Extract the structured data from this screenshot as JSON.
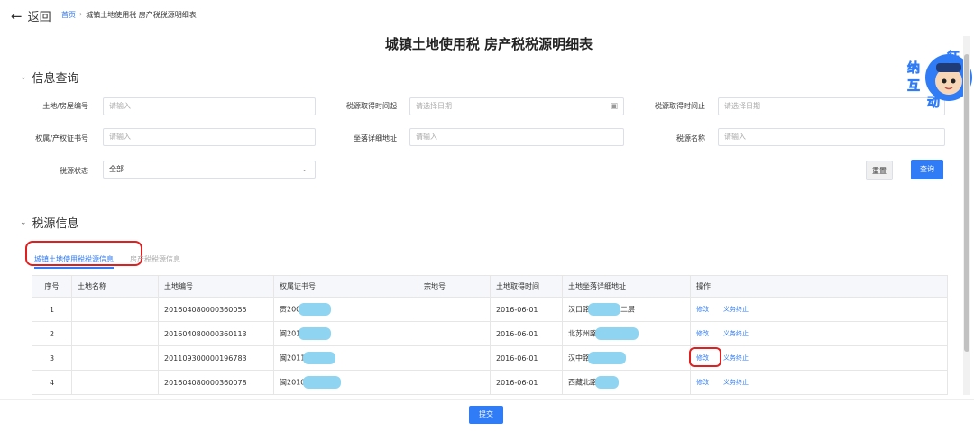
{
  "topbar": {
    "back_label": "返回",
    "breadcrumb_home": "首页",
    "breadcrumb_current": "城镇土地使用税 房产税税源明细表"
  },
  "page_title": "城镇土地使用税 房产税税源明细表",
  "query_section": {
    "heading": "信息查询",
    "fields": {
      "land_house_no": {
        "label": "土地/房屋编号",
        "placeholder": "请输入"
      },
      "start_date": {
        "label": "税源取得时间起",
        "placeholder": "请选择日期"
      },
      "end_date": {
        "label": "税源取得时间止",
        "placeholder": "请选择日期"
      },
      "cert_no": {
        "label": "权属/产权证书号",
        "placeholder": "请输入"
      },
      "address": {
        "label": "坐落详细地址",
        "placeholder": "请输入"
      },
      "tax_name": {
        "label": "税源名称",
        "placeholder": "请输入"
      },
      "status": {
        "label": "税源状态",
        "value": "全部"
      }
    },
    "reset_label": "重置",
    "query_label": "查询"
  },
  "info_section": {
    "heading": "税源信息",
    "tabs": [
      "城镇土地使用税税源信息",
      "房产税税源信息"
    ],
    "columns": [
      "序号",
      "土地名称",
      "土地编号",
      "权属证书号",
      "宗地号",
      "土地取得时间",
      "土地坐落详细地址",
      "操作"
    ],
    "rows": [
      {
        "idx": "1",
        "name": "",
        "land_no": "201604080000360055",
        "cert": "贾200",
        "plot": "",
        "date": "2016-06-01",
        "addr": "汉口路",
        "addr_tail": "二层"
      },
      {
        "idx": "2",
        "name": "",
        "land_no": "201604080000360113",
        "cert": "闽201",
        "plot": "",
        "date": "2016-06-01",
        "addr": "北苏州路",
        "addr_tail": ""
      },
      {
        "idx": "3",
        "name": "",
        "land_no": "201109300000196783",
        "cert": "闽2011",
        "plot": "",
        "date": "2016-06-01",
        "addr": "汉中路",
        "addr_tail": ""
      },
      {
        "idx": "4",
        "name": "",
        "land_no": "201604080000360078",
        "cert": "闽2010",
        "plot": "",
        "date": "2016-06-01",
        "addr": "西藏北路",
        "addr_tail": ""
      }
    ],
    "op_edit": "修改",
    "op_terminate": "义务终止"
  },
  "submit_label": "提交",
  "mascot": {
    "chars": [
      "征",
      "纳",
      "互",
      "动"
    ]
  },
  "colors": {
    "primary": "#2f7cf6",
    "highlight": "#e02020",
    "redacted": "#8fd4f0"
  }
}
